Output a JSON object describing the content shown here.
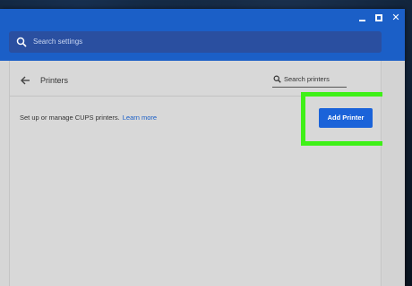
{
  "header": {
    "search_placeholder": "Search settings"
  },
  "page": {
    "title": "Printers",
    "search_printers_placeholder": "Search printers",
    "description": "Set up or manage CUPS printers.",
    "learn_more": "Learn more",
    "add_printer_label": "Add Printer"
  },
  "colors": {
    "accent": "#1b5fc7",
    "highlight": "#3ef017"
  },
  "icons": {
    "minimize": "minimize-icon",
    "maximize": "maximize-icon",
    "close": "close-icon",
    "search": "search-icon",
    "back": "back-arrow-icon"
  }
}
